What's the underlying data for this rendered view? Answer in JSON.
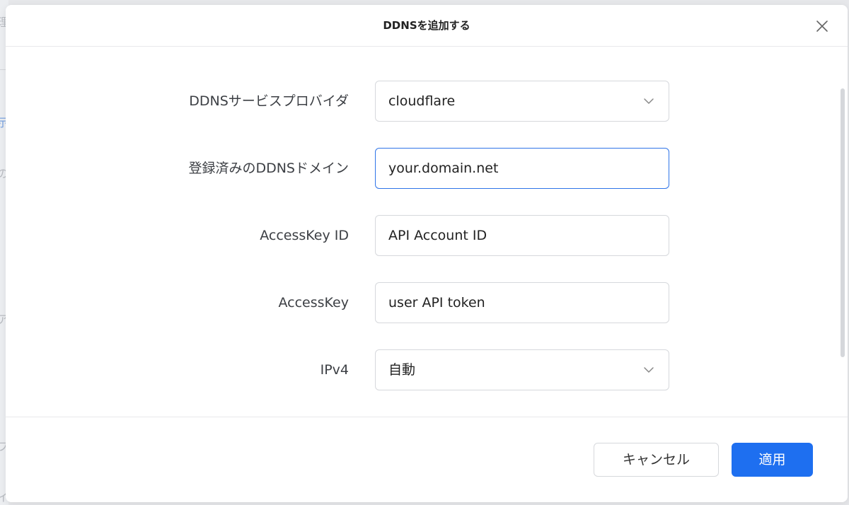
{
  "background": {
    "fragments": [
      "理",
      "示",
      "の",
      "ア",
      "フ",
      "イ"
    ]
  },
  "dialog": {
    "title": "DDNSを追加する",
    "close_icon": "close-icon"
  },
  "form": {
    "provider": {
      "label": "DDNSサービスプロバイダ",
      "value": "cloudflare",
      "icon": "chevron-down-icon"
    },
    "domain": {
      "label": "登録済みのDDNSドメイン",
      "value": "your.domain.net"
    },
    "access_key_id": {
      "label": "AccessKey ID",
      "value": "API Account ID"
    },
    "access_key": {
      "label": "AccessKey",
      "value": "user API token"
    },
    "ipv4": {
      "label": "IPv4",
      "value": "自動",
      "icon": "chevron-down-icon"
    }
  },
  "footer": {
    "cancel_label": "キャンセル",
    "apply_label": "適用"
  },
  "colors": {
    "accent": "#1e6ff0",
    "focus_border": "#2f74e8",
    "field_border": "#d6d8dc"
  }
}
